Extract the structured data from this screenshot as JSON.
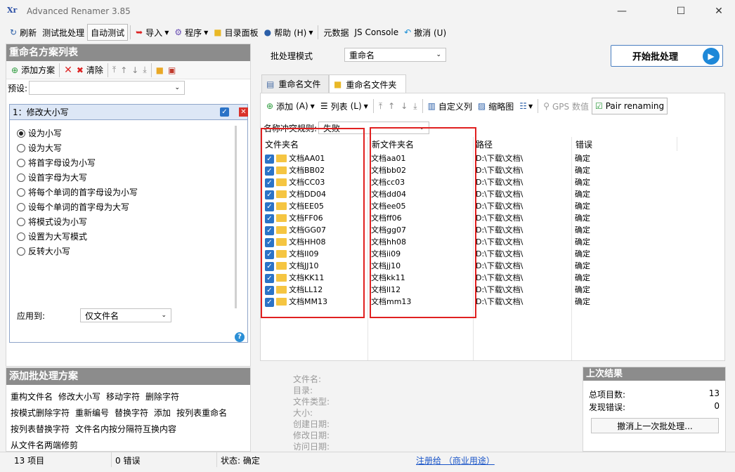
{
  "window": {
    "title": "Advanced Renamer 3.85",
    "app_icon": "Xr",
    "controls": {
      "minimize": "—",
      "maximize": "☐",
      "close": "✕"
    }
  },
  "toolbar": {
    "refresh": "刷新",
    "test_batch": "测试批处理",
    "auto_test": "自动测试",
    "import": "导入",
    "programs": "程序",
    "dir_panel": "目录面板",
    "help": "帮助 (H)",
    "metadata": "元数据",
    "js_console": "JS Console",
    "undo": "撤消 (U)"
  },
  "left": {
    "header": "重命名方案列表",
    "add_method": "添加方案",
    "clear": "清除",
    "preset_label": "预设:",
    "preset_value": "",
    "method_title": "1：修改大小写",
    "options": [
      "设为小写",
      "设为大写",
      "将首字母设为小写",
      "设首字母为大写",
      "将每个单词的首字母设为小写",
      "设每个单词的首字母为大写",
      "将模式设为小写",
      "设置为大写模式",
      "反转大小写"
    ],
    "selected_option": 0,
    "apply_label": "应用到:",
    "apply_value": "仅文件名",
    "help_icon": "?"
  },
  "add_methods": {
    "header": "添加批处理方案",
    "methods": [
      "重构文件名",
      "修改大小写",
      "移动字符",
      "删除字符",
      "按模式删除字符",
      "重新编号",
      "替换字符",
      "添加",
      "按列表重命名",
      "按列表替换字符",
      "文件名内按分隔符互换内容",
      "从文件名两端修剪"
    ]
  },
  "batch": {
    "mode_label": "批处理模式",
    "mode_value": "重命名",
    "start_button": "开始批处理"
  },
  "tabs": {
    "files": "重命名文件",
    "folders": "重命名文件夹"
  },
  "grid_toolbar": {
    "add": "添加",
    "add_key": "(A)",
    "list": "列表",
    "list_key": "(L)",
    "custom_columns": "自定义列",
    "thumbnails": "缩略图",
    "gps": "GPS 数值",
    "pair": "Pair renaming"
  },
  "conflict": {
    "label": "名称冲突规则:",
    "value": "失败"
  },
  "columns": [
    "文件夹名",
    "新文件夹名",
    "路径",
    "错误"
  ],
  "rows": [
    {
      "name": "文档AA01",
      "new": "文档aa01",
      "path": "D:\\下载\\文档\\",
      "error": "确定"
    },
    {
      "name": "文档BB02",
      "new": "文档bb02",
      "path": "D:\\下载\\文档\\",
      "error": "确定"
    },
    {
      "name": "文档CC03",
      "new": "文档cc03",
      "path": "D:\\下载\\文档\\",
      "error": "确定"
    },
    {
      "name": "文档DD04",
      "new": "文档dd04",
      "path": "D:\\下载\\文档\\",
      "error": "确定"
    },
    {
      "name": "文档EE05",
      "new": "文档ee05",
      "path": "D:\\下载\\文档\\",
      "error": "确定"
    },
    {
      "name": "文档FF06",
      "new": "文档ff06",
      "path": "D:\\下载\\文档\\",
      "error": "确定"
    },
    {
      "name": "文档GG07",
      "new": "文档gg07",
      "path": "D:\\下载\\文档\\",
      "error": "确定"
    },
    {
      "name": "文档HH08",
      "new": "文档hh08",
      "path": "D:\\下载\\文档\\",
      "error": "确定"
    },
    {
      "name": "文档II09",
      "new": "文档ii09",
      "path": "D:\\下载\\文档\\",
      "error": "确定"
    },
    {
      "name": "文档JJ10",
      "new": "文档jj10",
      "path": "D:\\下载\\文档\\",
      "error": "确定"
    },
    {
      "name": "文档KK11",
      "new": "文档kk11",
      "path": "D:\\下载\\文档\\",
      "error": "确定"
    },
    {
      "name": "文档LL12",
      "new": "文档ll12",
      "path": "D:\\下载\\文档\\",
      "error": "确定"
    },
    {
      "name": "文档MM13",
      "new": "文档mm13",
      "path": "D:\\下载\\文档\\",
      "error": "确定"
    }
  ],
  "info_labels": [
    "文件名:",
    "目录:",
    "文件类型:",
    "大小:",
    "创建日期:",
    "修改日期:",
    "访问日期:"
  ],
  "stats": {
    "header": "上次结果",
    "total_label": "总项目数:",
    "total_value": "13",
    "errors_label": "发现错误:",
    "errors_value": "0",
    "undo_button": "撤消上一次批处理..."
  },
  "status": {
    "items": "13 项目",
    "errors": "0 错误",
    "state": "状态: 确定",
    "register": "注册给 （商业用途）"
  },
  "colors": {
    "accent": "#2b73c7",
    "highlight_box": "#e02020",
    "section_header": "#8c8c8c"
  }
}
